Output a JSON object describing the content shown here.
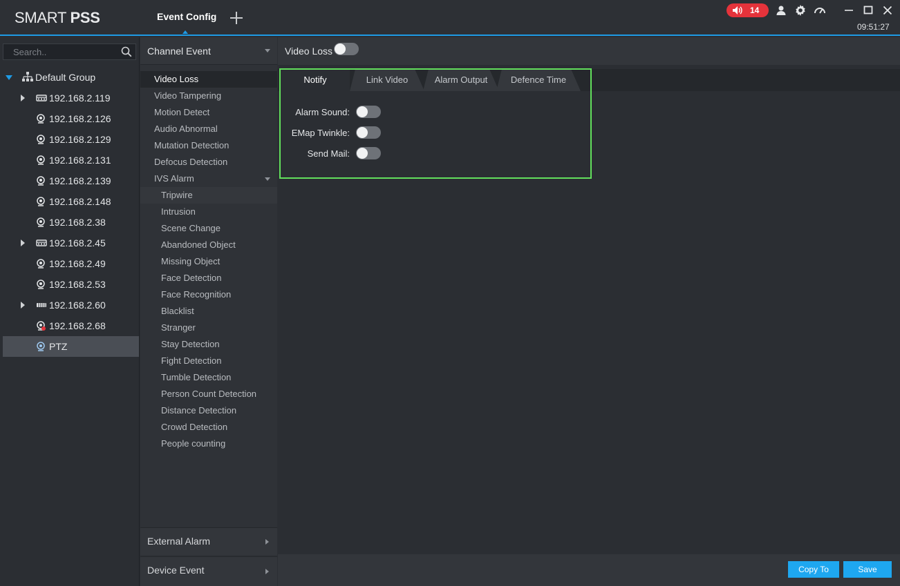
{
  "app": {
    "logo_light": "SMART ",
    "logo_bold": "PSS",
    "active_tab": "Event Config",
    "alarm_count": "14",
    "clock": "09:51:27",
    "accent": "#1e9be6",
    "alarm_color": "#e5333b"
  },
  "tree": {
    "search_placeholder": "Search..",
    "root": "Default Group",
    "devices": [
      {
        "label": "192.168.2.119",
        "icon": "nvr-icon"
      },
      {
        "label": "192.168.2.126",
        "icon": "camera-icon"
      },
      {
        "label": "192.168.2.129",
        "icon": "camera-icon"
      },
      {
        "label": "192.168.2.131",
        "icon": "camera-icon"
      },
      {
        "label": "192.168.2.139",
        "icon": "camera-icon"
      },
      {
        "label": "192.168.2.148",
        "icon": "camera-icon"
      },
      {
        "label": "192.168.2.38",
        "icon": "camera-icon"
      },
      {
        "label": "192.168.2.45",
        "icon": "nvr-icon"
      },
      {
        "label": "192.168.2.49",
        "icon": "camera-icon"
      },
      {
        "label": "192.168.2.53",
        "icon": "camera-icon"
      },
      {
        "label": "192.168.2.60",
        "icon": "dvr-icon"
      },
      {
        "label": "192.168.2.68",
        "icon": "camera-offline-icon"
      },
      {
        "label": "PTZ",
        "icon": "camera-selected-icon"
      }
    ]
  },
  "events": {
    "header": "Channel Event",
    "items": [
      "Video Loss",
      "Video Tampering",
      "Motion Detect",
      "Audio Abnormal",
      "Mutation Detection",
      "Defocus Detection",
      "IVS Alarm"
    ],
    "ivs_items": [
      "Tripwire",
      "Intrusion",
      "Scene Change",
      "Abandoned Object",
      "Missing Object",
      "Face Detection",
      "Face Recognition",
      "Blacklist",
      "Stranger",
      "Stay Detection",
      "Fight Detection",
      "Tumble Detection",
      "Person Count Detection",
      "Distance Detection",
      "Crowd Detection",
      "People counting"
    ],
    "external_alarm": "External Alarm",
    "device_event": "Device Event"
  },
  "config": {
    "header_label": "Video Loss",
    "tabs": [
      "Notify",
      "Link Video",
      "Alarm Output",
      "Defence Time"
    ],
    "fields": [
      "Alarm Sound:",
      "EMap Twinkle:",
      "Send Mail:"
    ],
    "copy_to": "Copy To",
    "save": "Save"
  }
}
